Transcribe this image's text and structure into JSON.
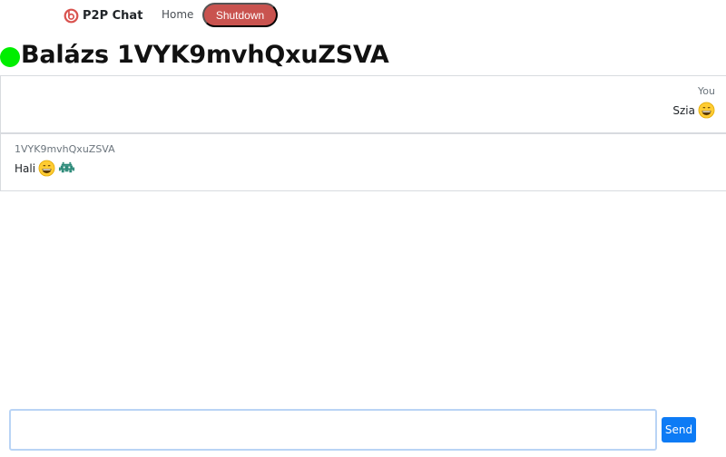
{
  "navbar": {
    "brand": "P2P Chat",
    "brand_icon": "p2p-logo-icon",
    "home_label": "Home",
    "shutdown_label": "Shutdown"
  },
  "chat": {
    "status_color": "#00ee00",
    "title": "Balázs 1VYK9mvhQxuZSVA"
  },
  "messages": [
    {
      "sender": "You",
      "text": "Szia",
      "emojis": [
        "grinning-face-icon"
      ]
    },
    {
      "sender": "1VYK9mvhQxuZSVA",
      "text": "Hali",
      "emojis": [
        "grinning-face-icon",
        "alien-monster-icon"
      ]
    }
  ],
  "composer": {
    "value": "",
    "send_label": "Send"
  },
  "colors": {
    "shutdown": "#c9534f",
    "send": "#0d7bf5",
    "online": "#00ee00"
  }
}
